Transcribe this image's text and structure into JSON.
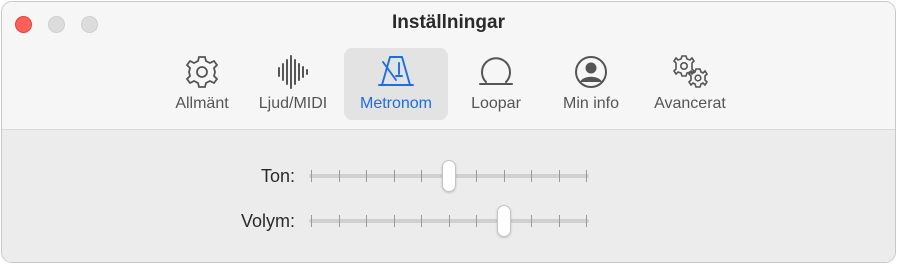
{
  "window": {
    "title": "Inställningar"
  },
  "toolbar": {
    "tabs": [
      {
        "label": "Allmänt",
        "icon": "gear-icon",
        "selected": false
      },
      {
        "label": "Ljud/MIDI",
        "icon": "waveform-icon",
        "selected": false
      },
      {
        "label": "Metronom",
        "icon": "metronome-icon",
        "selected": true
      },
      {
        "label": "Loopar",
        "icon": "loop-icon",
        "selected": false
      },
      {
        "label": "Min info",
        "icon": "person-circle-icon",
        "selected": false
      },
      {
        "label": "Avancerat",
        "icon": "gears-icon",
        "selected": false
      }
    ]
  },
  "metronome": {
    "tone": {
      "label": "Ton:",
      "ticks": 11,
      "value_fraction": 0.5
    },
    "volume": {
      "label": "Volym:",
      "ticks": 11,
      "value_fraction": 0.7
    }
  },
  "colors": {
    "accent": "#1a6ee8",
    "close_button": "#fe5f57"
  }
}
